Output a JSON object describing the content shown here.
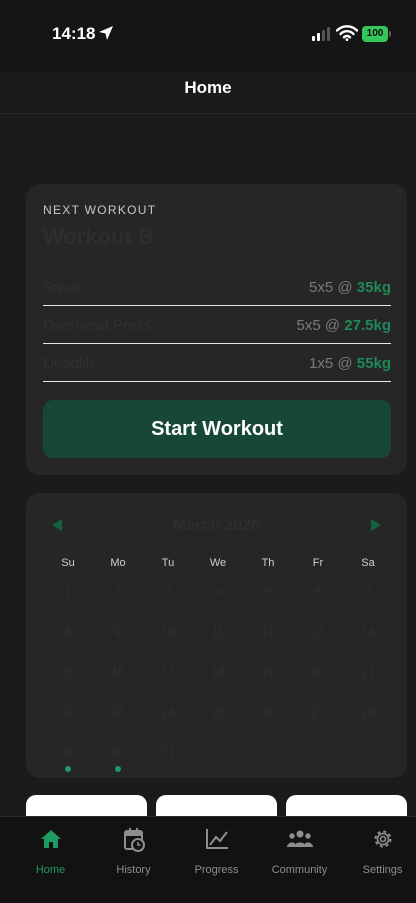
{
  "status_bar": {
    "time": "14:18",
    "battery": "100"
  },
  "nav": {
    "title": "Home"
  },
  "workout": {
    "kicker": "NEXT WORKOUT",
    "title": "Workout B",
    "exercises": [
      {
        "name": "Squat",
        "sets": "5x5 @ ",
        "weight": "35kg"
      },
      {
        "name": "Overhead Press",
        "sets": "5x5 @ ",
        "weight": "27.5kg"
      },
      {
        "name": "Deadlift",
        "sets": "1x5 @ ",
        "weight": "55kg"
      }
    ],
    "start_label": "Start Workout"
  },
  "calendar": {
    "month": "March 2026",
    "weekdays": [
      "Su",
      "Mo",
      "Tu",
      "We",
      "Th",
      "Fr",
      "Sa"
    ],
    "weeks": [
      [
        "1",
        "2",
        "3",
        "4",
        "5",
        "6",
        "7"
      ],
      [
        "8",
        "9",
        "10",
        "11",
        "12",
        "13",
        "14"
      ],
      [
        "15",
        "16",
        "17",
        "18",
        "19",
        "20",
        "21"
      ],
      [
        "22",
        "23",
        "24",
        "25",
        "26",
        "27",
        "28"
      ],
      [
        "29",
        "30",
        "31"
      ]
    ],
    "workout_days": [
      "29",
      "30"
    ]
  },
  "tabs": [
    {
      "label": "Home",
      "icon": "home-icon",
      "active": true
    },
    {
      "label": "History",
      "icon": "history-icon",
      "active": false
    },
    {
      "label": "Progress",
      "icon": "progress-chart-icon",
      "active": false
    },
    {
      "label": "Community",
      "icon": "community-icon",
      "active": false
    },
    {
      "label": "Settings",
      "icon": "settings-gear-icon",
      "active": false
    }
  ],
  "colors": {
    "accent": "#1f9a62",
    "button": "#174736",
    "battery": "#34c759"
  }
}
